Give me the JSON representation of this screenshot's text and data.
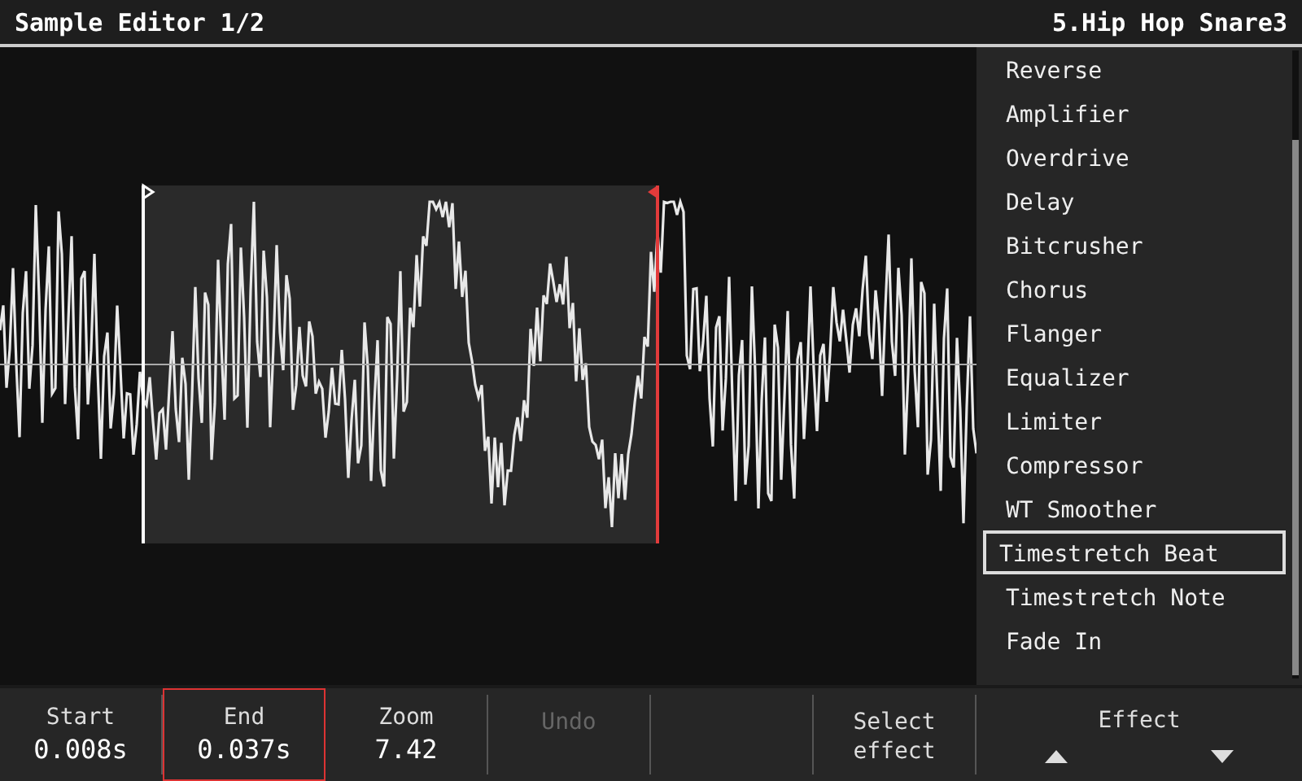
{
  "header": {
    "title": "Sample Editor 1/2",
    "sample": "5.Hip Hop Snare3"
  },
  "effects": [
    {
      "label": "Reverse",
      "selected": false
    },
    {
      "label": "Amplifier",
      "selected": false
    },
    {
      "label": "Overdrive",
      "selected": false
    },
    {
      "label": "Delay",
      "selected": false
    },
    {
      "label": "Bitcrusher",
      "selected": false
    },
    {
      "label": "Chorus",
      "selected": false
    },
    {
      "label": "Flanger",
      "selected": false
    },
    {
      "label": "Equalizer",
      "selected": false
    },
    {
      "label": "Limiter",
      "selected": false
    },
    {
      "label": "Compressor",
      "selected": false
    },
    {
      "label": "WT Smoother",
      "selected": false
    },
    {
      "label": "Timestretch Beat",
      "selected": true
    },
    {
      "label": "Timestretch Note",
      "selected": false
    },
    {
      "label": "Fade In",
      "selected": false
    }
  ],
  "controls": [
    {
      "kind": "value",
      "label": "Start",
      "value": "0.008s",
      "selected": false,
      "disabled": false
    },
    {
      "kind": "value",
      "label": "End",
      "value": "0.037s",
      "selected": true,
      "disabled": false
    },
    {
      "kind": "value",
      "label": "Zoom",
      "value": "7.42",
      "selected": false,
      "disabled": false
    },
    {
      "kind": "action",
      "label": "Undo",
      "selected": false,
      "disabled": true
    },
    {
      "kind": "empty"
    },
    {
      "kind": "action",
      "label": "Select effect",
      "selected": false,
      "disabled": false
    },
    {
      "kind": "arrows",
      "label": "Effect"
    }
  ]
}
